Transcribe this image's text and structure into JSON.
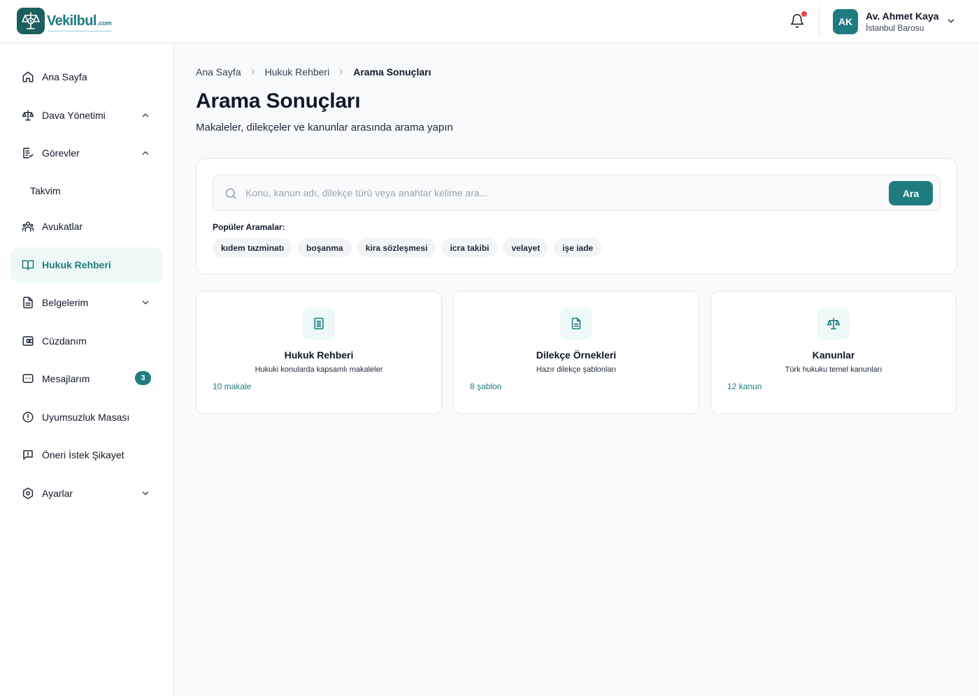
{
  "brand": {
    "name": "Vekilbul",
    "tld": ".com",
    "accent": "#1e7c7f",
    "alert": "#ef4444"
  },
  "header": {
    "notification_icon": "bell-icon",
    "has_unread": true,
    "user": {
      "initials": "AK",
      "name": "Av. Ahmet Kaya",
      "org": "İstanbul Barosu"
    }
  },
  "sidebar": {
    "items": [
      {
        "label": "Ana Sayfa",
        "icon": "home-icon"
      },
      {
        "label": "Dava Yönetimi",
        "icon": "scale-icon",
        "chevron": "up"
      },
      {
        "label": "Görevler",
        "icon": "task-list-icon",
        "chevron": "up"
      },
      {
        "label": "Takvim",
        "sub": true
      },
      {
        "label": "Avukatlar",
        "icon": "users-icon"
      },
      {
        "label": "Hukuk Rehberi",
        "icon": "book-icon",
        "active": true
      },
      {
        "label": "Belgelerim",
        "icon": "document-icon",
        "chevron": "down"
      },
      {
        "label": "Cüzdanım",
        "icon": "wallet-icon"
      },
      {
        "label": "Mesajlarım",
        "icon": "message-icon",
        "badge": "3"
      },
      {
        "label": "Uyumsuzluk Masası",
        "icon": "alert-circle-icon"
      },
      {
        "label": "Öneri İstek Şikayet",
        "icon": "feedback-icon"
      },
      {
        "label": "Ayarlar",
        "icon": "gear-icon",
        "chevron": "down"
      }
    ]
  },
  "main": {
    "breadcrumb": [
      "Ana Sayfa",
      "Hukuk Rehberi",
      "Arama Sonuçları"
    ],
    "title": "Arama Sonuçları",
    "subtitle": "Makaleler, dilekçeler ve kanunlar arasında arama yapın",
    "search": {
      "value": "",
      "placeholder": "Konu, kanun adı, dilekçe türü veya anahtar kelime ara...",
      "button_label": "Ara"
    },
    "popular": {
      "label": "Popüler Aramalar:",
      "tags": [
        "kıdem tazminatı",
        "boşanma",
        "kira sözleşmesi",
        "icra takibi",
        "velayet",
        "işe iade"
      ]
    },
    "categories": [
      {
        "title": "Hukuk Rehberi",
        "description": "Hukuki konularda kapsamlı makaleler",
        "count": "10 makale",
        "icon": "article-icon"
      },
      {
        "title": "Dilekçe Örnekleri",
        "description": "Hazır dilekçe şablonları",
        "count": "8 şablon",
        "icon": "file-text-icon"
      },
      {
        "title": "Kanunlar",
        "description": "Türk hukuku temel kanunları",
        "count": "12 kanun",
        "icon": "scale-icon"
      }
    ]
  }
}
